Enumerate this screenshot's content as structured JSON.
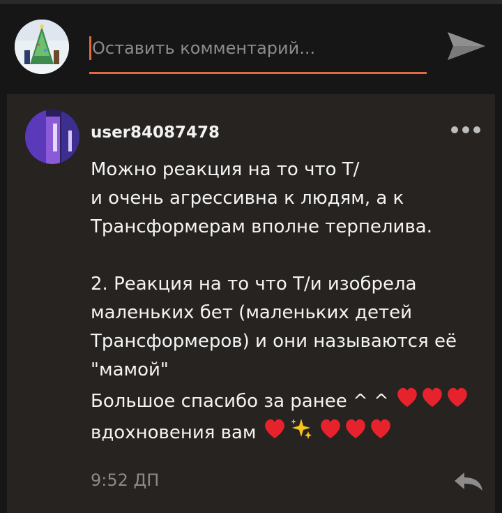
{
  "composer": {
    "placeholder": "Оставить комментарий...",
    "accent_color": "#e06a42"
  },
  "comment": {
    "username": "user84087478",
    "lines": [
      "Можно реакция на то что Т/",
      "и очень агрессивна к людям, а к",
      "Трансформерам вполне терпелива.",
      "",
      "2. Реакция на то что Т/и изобрела",
      "маленьких бет (маленьких детей",
      "Трансформеров) и они называются её",
      "\"мамой\"",
      "Большое спасибо за ранее ^ ^",
      "вдохновения вам"
    ],
    "emoji_line_9": [
      "heart",
      "heart",
      "heart"
    ],
    "emoji_line_10": [
      "heart",
      "sparkles",
      "heart",
      "heart",
      "heart"
    ],
    "time": "9:52 ДП"
  },
  "icons": {
    "send": "send-icon",
    "more": "more-options-icon",
    "reply": "reply-icon"
  }
}
